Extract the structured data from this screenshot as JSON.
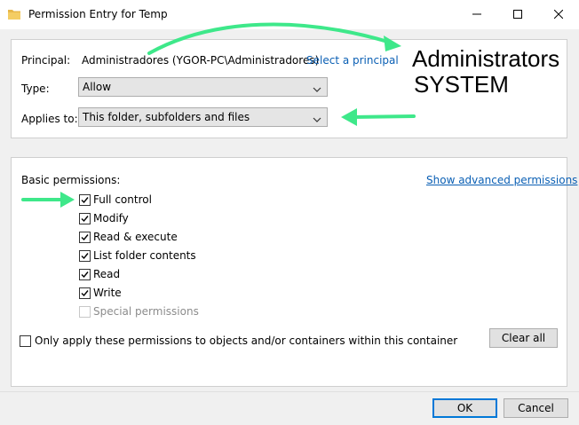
{
  "window": {
    "title": "Permission Entry for Temp",
    "minimize_icon": "minimize-icon",
    "maximize_icon": "maximize-icon",
    "close_icon": "close-icon"
  },
  "principal": {
    "label": "Principal:",
    "value": "Administradores (YGOR-PC\\Administradores)",
    "select_link": "Select a principal"
  },
  "type": {
    "label": "Type:",
    "selected": "Allow"
  },
  "applies_to": {
    "label": "Applies to:",
    "selected": "This folder, subfolders and files"
  },
  "permissions": {
    "heading": "Basic permissions:",
    "advanced_link": "Show advanced permissions",
    "items": [
      {
        "label": "Full control",
        "checked": true,
        "enabled": true
      },
      {
        "label": "Modify",
        "checked": true,
        "enabled": true
      },
      {
        "label": "Read & execute",
        "checked": true,
        "enabled": true
      },
      {
        "label": "List folder contents",
        "checked": true,
        "enabled": true
      },
      {
        "label": "Read",
        "checked": true,
        "enabled": true
      },
      {
        "label": "Write",
        "checked": true,
        "enabled": true
      },
      {
        "label": "Special permissions",
        "checked": false,
        "enabled": false
      }
    ],
    "only_apply_label": "Only apply these permissions to objects and/or containers within this container",
    "only_apply_checked": false,
    "clear_all": "Clear all"
  },
  "buttons": {
    "ok": "OK",
    "cancel": "Cancel"
  },
  "annotation": {
    "line1": "Administrators",
    "line2": "SYSTEM",
    "arrow_color": "#3ee88a"
  },
  "colors": {
    "link": "#0a5fb4",
    "default_button_border": "#0078d7",
    "window_bg": "#f0f0f0"
  }
}
